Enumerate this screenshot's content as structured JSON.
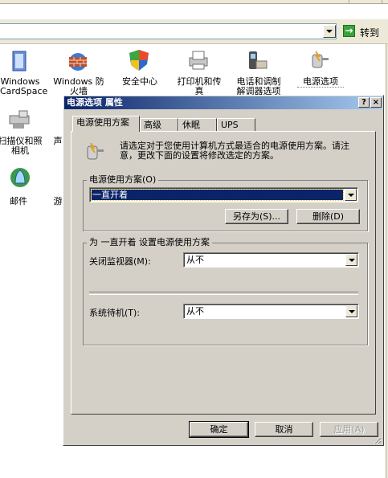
{
  "address_bar": {
    "go_label": "转到"
  },
  "control_panel_items": [
    {
      "label": "Windows\nCardSpace",
      "icon": "cardspace-icon"
    },
    {
      "label": "Windows 防\n火墙",
      "icon": "firewall-icon"
    },
    {
      "label": "安全中心",
      "icon": "security-center-icon"
    },
    {
      "label": "打印机和传\n真",
      "icon": "printer-icon"
    },
    {
      "label": "电话和调制\n解调器选项",
      "icon": "phone-modem-icon"
    },
    {
      "label": "电源选项",
      "icon": "power-options-icon"
    },
    {
      "label": "扫描仪和照\n相机",
      "icon": "scanner-icon"
    },
    {
      "label": "声",
      "icon": "sound-icon"
    },
    {
      "label": "邮件",
      "icon": "mail-icon"
    },
    {
      "label": "游",
      "icon": "game-icon"
    }
  ],
  "dialog": {
    "title": "电源选项 属性",
    "help_btn": "?",
    "close_btn": "×",
    "tabs": [
      "电源使用方案",
      "高级",
      "休眠",
      "UPS"
    ],
    "description": "请选定对于您使用计算机方式最适合的电源使用方案。请注意，更改下面的设置将修改选定的方案。",
    "scheme_group_label": "电源使用方案(O)",
    "scheme_value": "一直开着",
    "save_as_btn": "另存为(S)...",
    "delete_btn": "删除(D)",
    "settings_group_label": "为 一直开着 设置电源使用方案",
    "monitor_label": "关闭监视器(M):",
    "monitor_value": "从不",
    "standby_label": "系统待机(T):",
    "standby_value": "从不",
    "ok_btn": "确定",
    "cancel_btn": "取消",
    "apply_btn": "应用(A)"
  },
  "colors": {
    "title_start": "#0a246a",
    "title_end": "#a6caf0",
    "dialog_bg": "#d4d0c8",
    "selection": "#0a246a"
  }
}
